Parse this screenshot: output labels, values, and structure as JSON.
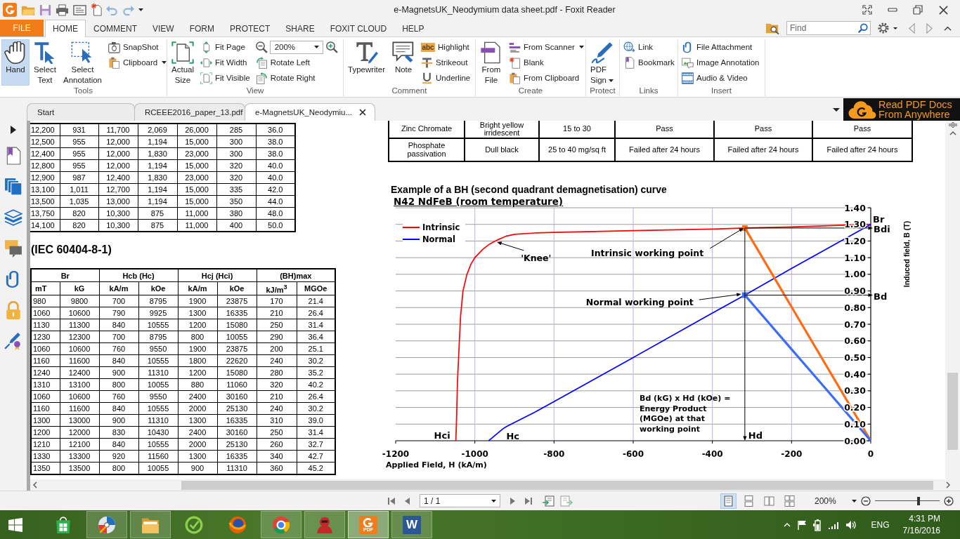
{
  "window": {
    "title": "e-MagnetsUK_Neodymium data sheet.pdf - Foxit Reader"
  },
  "ribbon": {
    "file_tab": "FILE",
    "tabs": [
      {
        "label": "HOME",
        "selected": true
      },
      {
        "label": "COMMENT",
        "selected": false
      },
      {
        "label": "VIEW",
        "selected": false
      },
      {
        "label": "FORM",
        "selected": false
      },
      {
        "label": "PROTECT",
        "selected": false
      },
      {
        "label": "SHARE",
        "selected": false
      },
      {
        "label": "FOXIT CLOUD",
        "selected": false
      },
      {
        "label": "HELP",
        "selected": false
      }
    ],
    "search": {
      "placeholder": "Find"
    },
    "groups": [
      {
        "label": "Tools",
        "items": [
          {
            "kind": "large",
            "label": "Hand",
            "selected": true,
            "dropdown": false
          },
          {
            "kind": "large",
            "label": "Select Text",
            "selected": false,
            "dropdown": false
          },
          {
            "kind": "large",
            "label": "Select Annotation",
            "selected": false,
            "dropdown": false
          },
          {
            "kind": "small",
            "label": "SnapShot",
            "selected": false,
            "dropdown": false
          },
          {
            "kind": "small",
            "label": "Clipboard",
            "selected": false,
            "dropdown": true
          }
        ]
      },
      {
        "label": "View",
        "items": [
          {
            "kind": "large",
            "label": "Actual Size",
            "dropdown": false
          },
          {
            "kind": "small",
            "label": "Fit Page",
            "dropdown": false
          },
          {
            "kind": "small",
            "label": "Fit Width",
            "dropdown": false
          },
          {
            "kind": "small",
            "label": "Fit Visible",
            "dropdown": false
          },
          {
            "kind": "combo",
            "value": "200%"
          },
          {
            "kind": "small",
            "label": "Rotate Left",
            "dropdown": false
          },
          {
            "kind": "small",
            "label": "Rotate Right",
            "dropdown": false
          }
        ]
      },
      {
        "label": "Comment",
        "items": [
          {
            "kind": "large",
            "label": "Typewriter",
            "dropdown": false
          },
          {
            "kind": "large",
            "label": "Note",
            "dropdown": false
          },
          {
            "kind": "small",
            "label": "Highlight",
            "icon_text": "abc",
            "dropdown": false
          },
          {
            "kind": "small",
            "label": "Strikeout",
            "dropdown": false
          },
          {
            "kind": "small",
            "label": "Underline",
            "dropdown": false
          }
        ]
      },
      {
        "label": "Create",
        "items": [
          {
            "kind": "large",
            "label": "From File",
            "dropdown": false
          },
          {
            "kind": "small",
            "label": "From Scanner",
            "dropdown": true
          },
          {
            "kind": "small",
            "label": "Blank",
            "dropdown": false
          },
          {
            "kind": "small",
            "label": "From Clipboard",
            "dropdown": false
          }
        ]
      },
      {
        "label": "Protect",
        "items": [
          {
            "kind": "large",
            "label": "PDF Sign",
            "dropdown": true
          }
        ]
      },
      {
        "label": "Links",
        "items": [
          {
            "kind": "small",
            "label": "Link",
            "dropdown": false
          },
          {
            "kind": "small",
            "label": "Bookmark",
            "dropdown": false
          }
        ]
      },
      {
        "label": "Insert",
        "items": [
          {
            "kind": "small",
            "label": "File Attachment",
            "dropdown": false
          },
          {
            "kind": "small",
            "label": "Image Annotation",
            "dropdown": false
          },
          {
            "kind": "small",
            "label": "Audio & Video",
            "dropdown": false
          }
        ]
      }
    ]
  },
  "document_tabs": [
    {
      "label": "Start",
      "selected": false
    },
    {
      "label": "RCEEE2016_paper_13.pdf",
      "selected": false
    },
    {
      "label": "e-MagnetsUK_Neodymiu...",
      "selected": true
    }
  ],
  "ad_banner": {
    "lines": [
      "Read PDF Docs",
      "From Anywhere"
    ]
  },
  "document": {
    "upper_table": {
      "rows": [
        [
          "12,200",
          "931",
          "11,700",
          "2,069",
          "26,000",
          "285",
          "36.0"
        ],
        [
          "12,500",
          "955",
          "12,000",
          "1,194",
          "15,000",
          "300",
          "38.0"
        ],
        [
          "12,400",
          "955",
          "12,000",
          "1,830",
          "23,000",
          "300",
          "38.0"
        ],
        [
          "12,800",
          "955",
          "12,000",
          "1,194",
          "15,000",
          "320",
          "40.0"
        ],
        [
          "12,900",
          "987",
          "12,400",
          "1,830",
          "23,000",
          "320",
          "40.0"
        ],
        [
          "13,100",
          "1,011",
          "12,700",
          "1,194",
          "15,000",
          "335",
          "42.0"
        ],
        [
          "13,500",
          "1,035",
          "13,000",
          "1,194",
          "15,000",
          "350",
          "44.0"
        ],
        [
          "13,750",
          "820",
          "10,300",
          "875",
          "11,000",
          "380",
          "48.0"
        ],
        [
          "14,100",
          "820",
          "10,300",
          "875",
          "11,000",
          "400",
          "50.0"
        ]
      ]
    },
    "standard_heading": "(IEC 60404-8-1)",
    "lower_table": {
      "group_headers": [
        "Br",
        "Hcb (Hc)",
        "Hcj (Hci)",
        "(BH)max"
      ],
      "unit_headers": [
        "mT",
        "kG",
        "kA/m",
        "kOe",
        "kA/m",
        "kOe",
        "kJ/m$^{3}$",
        "MGOe"
      ],
      "rows": [
        [
          "980",
          "9800",
          "700",
          "8795",
          "1900",
          "23875",
          "170",
          "21.4"
        ],
        [
          "1060",
          "10600",
          "790",
          "9925",
          "1300",
          "16335",
          "210",
          "26.4"
        ],
        [
          "1130",
          "11300",
          "840",
          "10555",
          "1200",
          "15080",
          "250",
          "31.4"
        ],
        [
          "1230",
          "12300",
          "700",
          "8795",
          "800",
          "10055",
          "290",
          "36.4"
        ],
        [
          "1060",
          "10600",
          "760",
          "9550",
          "1900",
          "23875",
          "200",
          "25.1"
        ],
        [
          "1160",
          "11600",
          "840",
          "10555",
          "1800",
          "22620",
          "240",
          "30.2"
        ],
        [
          "1240",
          "12400",
          "900",
          "11310",
          "1200",
          "15080",
          "280",
          "35.2"
        ],
        [
          "1310",
          "13100",
          "800",
          "10055",
          "880",
          "11060",
          "320",
          "40.2"
        ],
        [
          "1060",
          "10600",
          "760",
          "9550",
          "2400",
          "30160",
          "210",
          "26.4"
        ],
        [
          "1160",
          "11600",
          "840",
          "10555",
          "2000",
          "25130",
          "240",
          "30.2"
        ],
        [
          "1300",
          "13000",
          "900",
          "11310",
          "1300",
          "16335",
          "310",
          "39.0"
        ],
        [
          "1200",
          "12000",
          "830",
          "10430",
          "2400",
          "30160",
          "250",
          "31.4"
        ],
        [
          "1210",
          "12100",
          "840",
          "10555",
          "2000",
          "25130",
          "260",
          "32.7"
        ],
        [
          "1330",
          "13300",
          "920",
          "11560",
          "1300",
          "16335",
          "340",
          "42.7"
        ],
        [
          "1350",
          "13500",
          "800",
          "10055",
          "900",
          "11310",
          "360",
          "45.2"
        ]
      ]
    },
    "coating_table": {
      "rows": [
        [
          "Zinc Chromate",
          "Bright yellow irridescent",
          "15 to 30",
          "Pass",
          "Pass",
          "Pass"
        ],
        [
          "Phosphate passivation",
          "Dull black",
          "25 to 40 mg/sq ft",
          "Failed after 24 hours",
          "Failed after 24 hours",
          "Failed after 24 hours"
        ]
      ]
    },
    "chart_subtitle": "N42 NdFeB (room temperature)",
    "chart_data": {
      "type": "line",
      "title": "Example of a BH (second quadrant demagnetisation) curve",
      "xlabel": "Applied Field, H (kA/m)",
      "ylabel": "Induced field, B (T)",
      "x": [
        -1048,
        -1046,
        -1044,
        -1040,
        -1036,
        -1030,
        -1020,
        -1010,
        -1000,
        -980,
        -965,
        -960,
        -950,
        -940,
        -930,
        -920,
        -900,
        -850,
        -800,
        -600,
        -400,
        -318,
        -200,
        0
      ],
      "series": [
        {
          "name": "Intrinsic",
          "color": "#ff0000",
          "values": [
            0,
            0.15,
            0.35,
            0.55,
            0.75,
            0.9,
            1.0,
            1.06,
            1.1,
            1.15,
            1.178,
            1.185,
            1.198,
            1.21,
            1.22,
            1.23,
            1.24,
            1.248,
            1.252,
            1.262,
            1.272,
            1.278,
            1.285,
            1.3
          ]
        },
        {
          "name": "Normal",
          "color": "#0000ff",
          "values": [
            null,
            null,
            null,
            null,
            null,
            null,
            null,
            null,
            null,
            null,
            0,
            0.01,
            0.03,
            0.05,
            0.07,
            0.085,
            0.11,
            0.17,
            0.235,
            0.5,
            0.767,
            0.875,
            1.035,
            1.3
          ]
        },
        {
          "color": "#ff6a13",
          "values": [
            null,
            null,
            null,
            null,
            null,
            null,
            null,
            null,
            null,
            null,
            null,
            null,
            null,
            null,
            null,
            null,
            null,
            null,
            null,
            null,
            null,
            1.278,
            0.804,
            0
          ]
        },
        {
          "color": "#3a6cf5",
          "values": [
            null,
            null,
            null,
            null,
            null,
            null,
            null,
            null,
            null,
            null,
            null,
            null,
            null,
            null,
            null,
            null,
            null,
            null,
            null,
            null,
            null,
            0.875,
            0.55,
            0
          ]
        }
      ],
      "xlim": [
        -1200,
        0
      ],
      "ylim": [
        0,
        1.4
      ],
      "xticks": [
        -1200,
        -1000,
        -800,
        -600,
        -400,
        -200,
        0
      ],
      "yticks": [
        {
          "value": 0,
          "label": "0.00"
        },
        {
          "value": 0.1,
          "label": "0.10"
        },
        {
          "value": 0.2,
          "label": "0.20"
        },
        {
          "value": 0.3,
          "label": "0.30"
        },
        {
          "value": 0.4,
          "label": "0.40"
        },
        {
          "value": 0.5,
          "label": "0.50"
        },
        {
          "value": 0.6,
          "label": "0.60"
        },
        {
          "value": 0.7,
          "label": "0.70"
        },
        {
          "value": 0.8,
          "label": "0.80"
        },
        {
          "value": 0.9,
          "label": "0.90"
        },
        {
          "value": 1.0,
          "label": "1.00"
        },
        {
          "value": 1.1,
          "label": "1.10"
        },
        {
          "value": 1.2,
          "label": "1.20"
        },
        {
          "value": 1.3,
          "label": "1.30"
        },
        {
          "value": 1.4,
          "label": "1.40"
        }
      ],
      "grid": true,
      "legend": "upper left",
      "ref_lines": [
        {
          "axis": "x",
          "value": -318,
          "label": "Hd"
        },
        {
          "axis": "y",
          "value": 1.278,
          "label": "Bdi"
        },
        {
          "axis": "y",
          "value": 0.875,
          "label": "Bd"
        }
      ],
      "annotations": [
        {
          "text": "'Knee'",
          "x": -944,
          "y": 1.194
        },
        {
          "text": "Intrinsic working point",
          "x": -321,
          "y": 1.278
        },
        {
          "text": "Normal working point",
          "x": -327,
          "y": 0.881
        },
        "Bd (kG) x Hd (kOe) =\nEnergy Product\n(MGOe) at that\nworking point",
        {
          "text": "Hci",
          "x": -1048,
          "y": 0
        },
        {
          "text": "Hc",
          "x": -965,
          "y": 0
        },
        {
          "text": "Br",
          "x": 0,
          "y": 1.3
        }
      ]
    }
  },
  "status_bar": {
    "page": "1 / 1",
    "view_modes": [
      {
        "selected": true
      },
      {
        "selected": false
      },
      {
        "selected": false
      },
      {
        "selected": false
      }
    ],
    "zoom": "200%",
    "zoom_slider": {
      "level": 0.68
    }
  },
  "taskbar": {
    "apps": [
      {
        "running": false,
        "selected": false
      },
      {
        "running": true,
        "selected": false
      },
      {
        "running": true,
        "selected": false
      },
      {
        "running": false,
        "selected": false
      },
      {
        "running": false,
        "selected": false
      },
      {
        "running": true,
        "selected": false
      },
      {
        "running": true,
        "selected": false
      },
      {
        "running": true,
        "selected": true,
        "logo_text": "PDF"
      },
      {
        "running": true,
        "selected": false,
        "logo_text": "W"
      }
    ],
    "tray": {
      "language": "ENG",
      "time": "4:31 PM",
      "date": "7/16/2016"
    }
  }
}
